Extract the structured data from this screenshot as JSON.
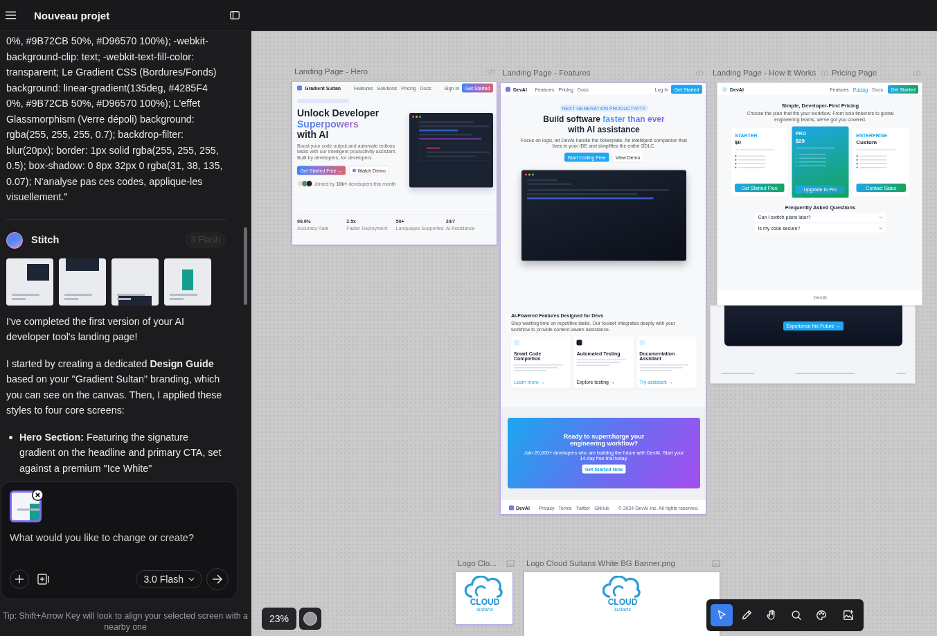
{
  "header": {
    "title": "Nouveau projet"
  },
  "chat": {
    "prompt_tail": "0%, #9B72CB 50%, #D96570 100%); -webkit-background-clip: text; -webkit-text-fill-color: transparent; Le Gradient CSS (Bordures/Fonds) background: linear-gradient(135deg, #4285F4 0%, #9B72CB 50%, #D96570 100%); L'effet Glassmorphism (Verre dépoli) background: rgba(255, 255, 255, 0.7); backdrop-filter: blur(20px); border: 1px solid rgba(255, 255, 255, 0.5); box-shadow: 0 8px 32px 0 rgba(31, 38, 135, 0.07); N'analyse pas ces codes, applique-les visuellement.\"",
    "author": "Stitch",
    "badge": "3 Flash",
    "thumbnails": [
      {
        "kind": "hero"
      },
      {
        "kind": "features"
      },
      {
        "kind": "how_it_works"
      },
      {
        "kind": "pricing"
      }
    ],
    "paragraphs": [
      "I've completed the first version of your AI developer tool's landing page!",
      "I started by creating a dedicated **Design Guide** based on your \"Gradient Sultan\" branding, which you can see on the canvas. Then, I applied these styles to four core screens:"
    ],
    "bullets": [
      "**Hero Section:** Featuring the signature gradient on the headline and primary CTA, set against a premium \"Ice White\""
    ]
  },
  "composer": {
    "attachment": {
      "kind": "pricing"
    },
    "placeholder": "What would you like to change or create?",
    "model": "3.0 Flash"
  },
  "tip": "Tip: Shift+Arrow Key will look to align your selected screen with a nearby one",
  "canvas": {
    "frames": [
      {
        "kind": "hero",
        "label": "Landing Page - Hero",
        "brand": "Gradient Sultan",
        "nav": [
          "Features",
          "Solutions",
          "Pricing",
          "Docs"
        ],
        "signin": "Sign In",
        "cta": "Get Started",
        "headline": [
          "Unlock Developer",
          "Superpowers",
          "with AI"
        ],
        "description": "Boost your code output and automate tedious tasks with our intelligent productivity assistant. Built by developers, for developers.",
        "primary": "Get Started Free →",
        "secondary": "Watch Demo",
        "social": "Joined by **10k+** developers this month",
        "stats": [
          {
            "value": "99.9%",
            "label": "Accuracy Rate"
          },
          {
            "value": "2.5x",
            "label": "Faster Deployment"
          },
          {
            "value": "50+",
            "label": "Languages Supported"
          },
          {
            "value": "24/7",
            "label": "AI Assistance"
          }
        ]
      },
      {
        "kind": "features",
        "label": "Landing Page - Features",
        "brand": "DevAI",
        "nav": [
          "Features",
          "Pricing",
          "Docs"
        ],
        "login": "Log In",
        "cta": "Get Started",
        "pill": "NEXT GENERATION PRODUCTIVITY",
        "headline": "Build software",
        "accent": "faster than ever",
        "headline2": "with AI assistance",
        "description": "Focus on logic, let DevAI handle the boilerplate. An intelligent companion that lives in your IDE and simplifies the entire SDLC.",
        "primary": "Start Coding Free",
        "secondary": "View Demo",
        "section_title": "AI-Powered Features Designed for Devs",
        "section_text": "Stop wasting time on repetitive tasks. Our toolset integrates deeply with your workflow to provide context-aware assistance.",
        "cards": [
          {
            "title": "Smart Code Completion",
            "link": "Learn more →",
            "dark": false
          },
          {
            "title": "Automated Testing",
            "link": "Explore testing →",
            "dark": true
          },
          {
            "title": "Documentation Assistant",
            "link": "Try assistant →",
            "dark": false
          }
        ],
        "banner_title": "Ready to supercharge your engineering workflow?",
        "banner_text": "Join 20,000+ developers who are building the future with DevAI. Start your 14-day free trial today.",
        "banner_button": "Get Started Now",
        "footer_brand": "DevAI",
        "footer_links": [
          "Privacy",
          "Terms",
          "Twitter",
          "GitHub"
        ],
        "copyright": "© 2024 DevAI Inc. All rights reserved."
      },
      {
        "kind": "how_it_works",
        "label": "Landing Page - How It Works",
        "button": "Experience the Future →"
      },
      {
        "kind": "pricing",
        "label": "Pricing Page",
        "brand": "DevAI",
        "nav": [
          {
            "text": "Features",
            "selected": false
          },
          {
            "text": "Pricing",
            "selected": true
          },
          {
            "text": "Docs",
            "selected": false
          }
        ],
        "cta": "Get Started",
        "title": "Simple, Developer-First Pricing",
        "subtitle": "Choose the plan that fits your workflow. From solo tinkerers to global engineering teams, we've got you covered.",
        "plans": [
          {
            "tier": "STARTER",
            "price": "$0",
            "featured": false,
            "button": "Get Started Free"
          },
          {
            "tier": "PRO",
            "price": "$29",
            "featured": true,
            "button": "Upgrade to Pro"
          },
          {
            "tier": "ENTERPRISE",
            "price": "Custom",
            "featured": false,
            "button": "Contact Sales"
          }
        ],
        "faq_title": "Frequently Asked Questions",
        "faqs": [
          "Can I switch plans later?",
          "Is my code secure?"
        ],
        "footer": "DevAI"
      },
      {
        "kind": "logo",
        "label": "Logo Clo...",
        "logo": "CLOUD",
        "tagline": "sultans"
      },
      {
        "kind": "logo",
        "label": "Logo Cloud Sultans White BG Banner.png",
        "logo": "CLOUD",
        "tagline": "sultans"
      }
    ],
    "zoom": "23%"
  },
  "toolbar": [
    {
      "kind": "select",
      "selected": true
    },
    {
      "kind": "pen",
      "selected": false
    },
    {
      "kind": "hand",
      "selected": false
    },
    {
      "kind": "search",
      "selected": false
    },
    {
      "kind": "palette",
      "selected": false
    },
    {
      "kind": "image",
      "selected": false
    }
  ]
}
